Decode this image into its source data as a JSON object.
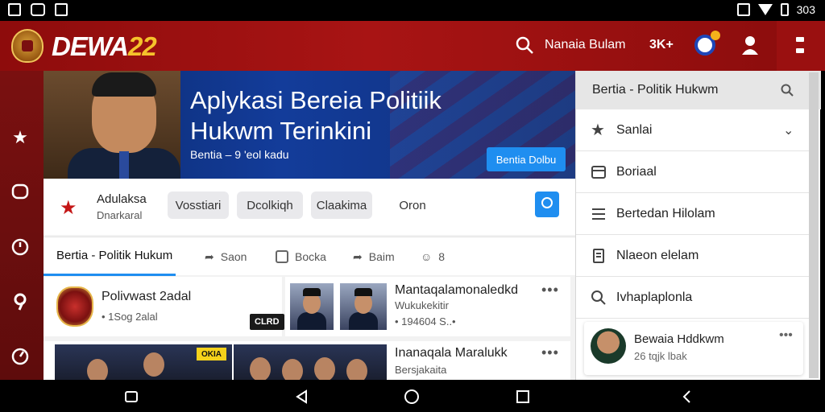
{
  "status_bar": {
    "time": "303"
  },
  "app_bar": {
    "brand_main": "DEWA",
    "brand_num": "22",
    "search_text": "Nanaia Bulam",
    "badge_text": "3K+"
  },
  "hero": {
    "title": "Aplykasi Bereia Politiik Hukwm  Terinkini",
    "subtitle": "Bentia – 9 'eol kadu",
    "button_label": "Bentia Dolbu"
  },
  "filter_bar": {
    "title": "Adulaksa",
    "subtitle": "Dnarkaral",
    "chips": [
      "Vosstiari",
      "Dcolkiqh",
      "Claakima",
      "Oron"
    ]
  },
  "tabs": [
    {
      "label": "Bertia - Politik Hukum"
    },
    {
      "label": "Saon"
    },
    {
      "label": "Bocka"
    },
    {
      "label": "Baim"
    },
    {
      "label": "8"
    }
  ],
  "feed": {
    "card1": {
      "title": "Polivwast 2adal",
      "meta": "• 1Sog 2alal",
      "tag": "CLRD"
    },
    "card2": {
      "title": "Mantaqalamonaledkd",
      "subtitle": "Wukukekitir",
      "meta": "• 194604 S..•"
    },
    "card3": {
      "title": "Inanaqala Maralukk",
      "subtitle": "Bersjakaita",
      "tag": "OKIA"
    },
    "more_glyph": "•••"
  },
  "panel": {
    "title": "Bertia - Politik Hukwm",
    "items": [
      {
        "label": "Sanlai",
        "icon": "star-icon"
      },
      {
        "label": "Boriaal",
        "icon": "calendar-icon"
      },
      {
        "label": "Bertedan Hilolam",
        "icon": "list-icon"
      },
      {
        "label": "Nlaeon elelam",
        "icon": "bookmark-list-icon"
      },
      {
        "label": "Ivhaplaplonla",
        "icon": "search-icon"
      }
    ],
    "card": {
      "title": "Bewaia Hddkwm",
      "subtitle": "26 tqjk lbak"
    }
  },
  "colors": {
    "app_bar": "#a81414",
    "rail": "#6a0e0e",
    "accent": "#1f8ef0",
    "brand_gold": "#f5c22b"
  }
}
